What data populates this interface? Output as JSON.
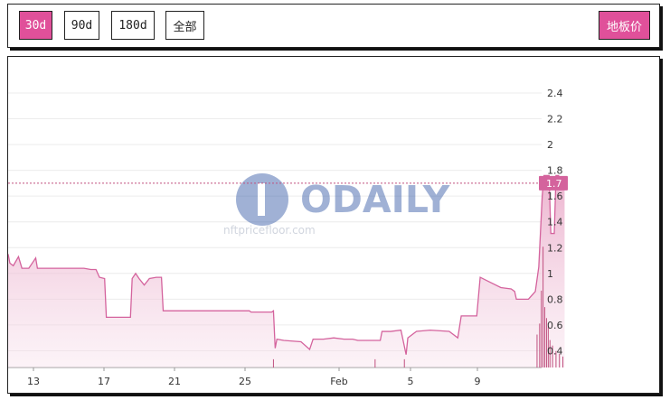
{
  "toolbar": {
    "ranges": [
      "30d",
      "90d",
      "180d",
      "全部"
    ],
    "active_range": "30d",
    "metric_label": "地板价"
  },
  "colors": {
    "accent": "#e0509a",
    "line": "#d4639d",
    "fill_top": "#e9a6c6"
  },
  "watermark": {
    "brand": "ODAILY",
    "site": "nftpricefloor.com"
  },
  "chart_data": {
    "type": "area",
    "x_tick_labels": [
      "13",
      "17",
      "21",
      "25",
      "Feb",
      "5",
      "9"
    ],
    "y_tick_labels": [
      "0.4",
      "0.6",
      "0.8",
      "1",
      "1.2",
      "1.4",
      "1.6",
      "1.8",
      "2",
      "2.2",
      "2.4"
    ],
    "ylim": [
      0.27,
      2.4
    ],
    "current_value_label": "1.7",
    "current_value": 1.7,
    "x_axis": "day index, 0 = 12 Jan",
    "xlim": [
      0,
      30.65
    ],
    "series": [
      {
        "values": [
          [
            0,
            1.15
          ],
          [
            0.1,
            1.08
          ],
          [
            0.3,
            1.06
          ],
          [
            0.6,
            1.13
          ],
          [
            0.8,
            1.04
          ],
          [
            1.2,
            1.04
          ],
          [
            1.6,
            1.12
          ],
          [
            1.7,
            1.04
          ],
          [
            2.3,
            1.04
          ],
          [
            4.2,
            1.04
          ],
          [
            4.4,
            1.04
          ],
          [
            4.8,
            1.03
          ],
          [
            5.1,
            1.03
          ],
          [
            5.3,
            0.97
          ],
          [
            5.6,
            0.96
          ],
          [
            5.7,
            0.66
          ],
          [
            6.5,
            0.66
          ],
          [
            6.9,
            0.66
          ],
          [
            7.1,
            0.66
          ],
          [
            7.2,
            0.96
          ],
          [
            7.4,
            1.0
          ],
          [
            7.6,
            0.96
          ],
          [
            7.9,
            0.91
          ],
          [
            8.2,
            0.96
          ],
          [
            8.6,
            0.97
          ],
          [
            8.9,
            0.97
          ],
          [
            9.0,
            0.71
          ],
          [
            12.5,
            0.71
          ],
          [
            14.0,
            0.71
          ],
          [
            14.1,
            0.7
          ],
          [
            15.3,
            0.7
          ],
          [
            15.4,
            0.71
          ],
          [
            15.5,
            0.42
          ],
          [
            15.6,
            0.49
          ],
          [
            16.0,
            0.48
          ],
          [
            17.0,
            0.47
          ],
          [
            17.5,
            0.41
          ],
          [
            17.7,
            0.49
          ],
          [
            18.3,
            0.49
          ],
          [
            18.9,
            0.5
          ],
          [
            19.5,
            0.49
          ],
          [
            20.0,
            0.49
          ],
          [
            20.3,
            0.48
          ],
          [
            21.6,
            0.48
          ],
          [
            21.7,
            0.55
          ],
          [
            22.2,
            0.55
          ],
          [
            22.8,
            0.56
          ],
          [
            23.1,
            0.37
          ],
          [
            23.2,
            0.5
          ],
          [
            23.7,
            0.55
          ],
          [
            24.5,
            0.56
          ],
          [
            25.6,
            0.55
          ],
          [
            26.1,
            0.5
          ],
          [
            26.3,
            0.67
          ],
          [
            26.8,
            0.67
          ],
          [
            27.2,
            0.67
          ],
          [
            27.4,
            0.97
          ],
          [
            28.0,
            0.93
          ],
          [
            28.6,
            0.89
          ],
          [
            29.2,
            0.88
          ],
          [
            29.4,
            0.86
          ],
          [
            29.5,
            0.8
          ],
          [
            30.2,
            0.8
          ],
          [
            30.6,
            0.86
          ],
          [
            30.8,
            1.05
          ],
          [
            31.0,
            1.6
          ],
          [
            31.1,
            1.76
          ],
          [
            31.4,
            1.76
          ],
          [
            31.5,
            1.31
          ],
          [
            31.7,
            1.31
          ],
          [
            31.8,
            1.76
          ],
          [
            31.95,
            1.76
          ],
          [
            32.1,
            1.7
          ],
          [
            32.3,
            1.71
          ]
        ]
      }
    ],
    "volume_spikes": [
      [
        30.7,
        0.12
      ],
      [
        30.85,
        0.16
      ],
      [
        30.95,
        0.28
      ],
      [
        31.05,
        0.44
      ],
      [
        31.15,
        0.22
      ],
      [
        31.25,
        0.18
      ],
      [
        31.35,
        0.15
      ],
      [
        31.45,
        0.1
      ],
      [
        31.6,
        0.08
      ],
      [
        31.8,
        0.06
      ],
      [
        32.0,
        0.05
      ],
      [
        32.2,
        0.04
      ],
      [
        15.4,
        0.03
      ],
      [
        21.3,
        0.03
      ],
      [
        23.0,
        0.03
      ]
    ]
  }
}
